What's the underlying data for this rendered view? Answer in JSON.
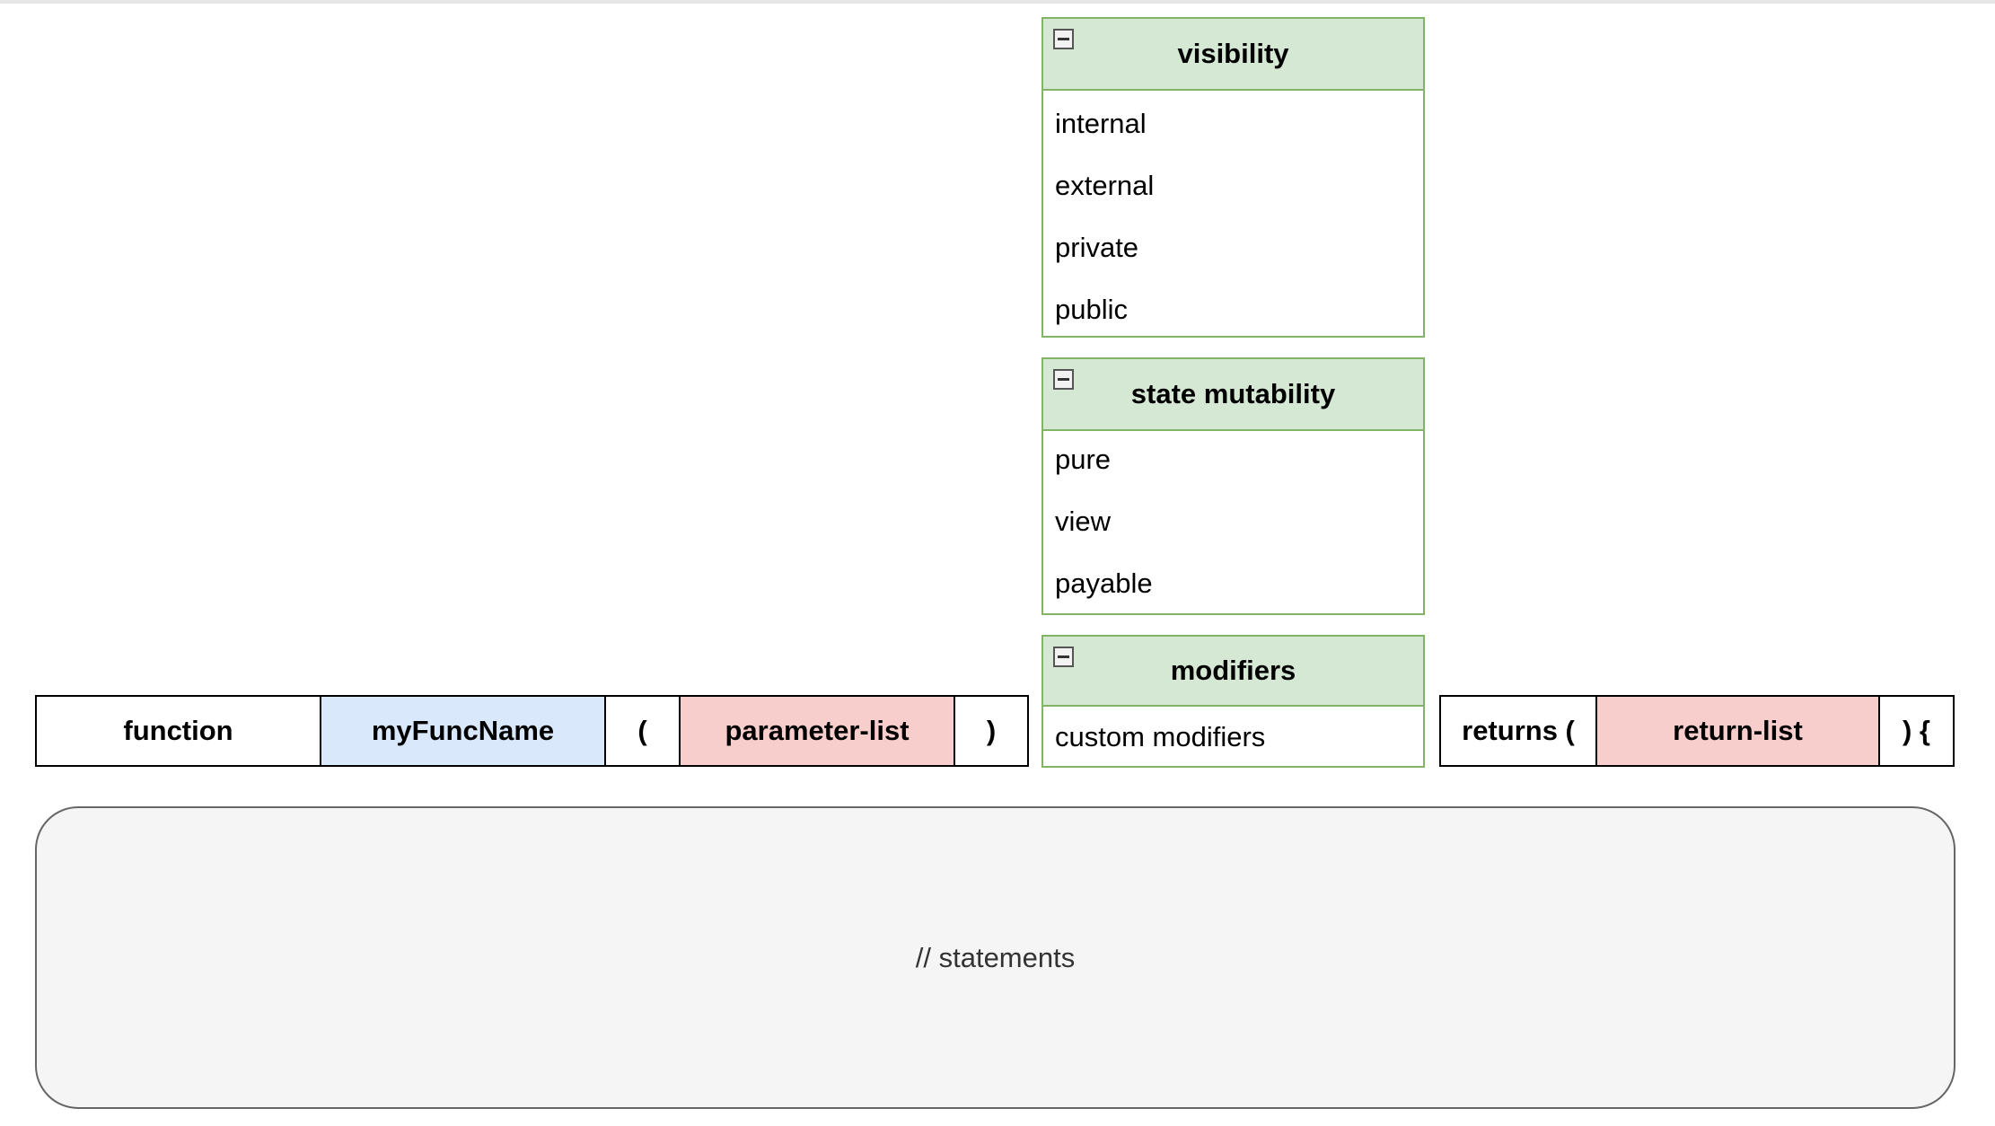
{
  "signature": {
    "keyword": "function",
    "name": "myFuncName",
    "open_paren": "(",
    "params": "parameter-list",
    "close_paren": ")",
    "returns_keyword": "returns (",
    "returns_list": "return-list",
    "close_brace": ") {"
  },
  "panels": {
    "visibility": {
      "title": "visibility",
      "items": [
        "internal",
        "external",
        "private",
        "public"
      ]
    },
    "state_mutability": {
      "title": "state mutability",
      "items": [
        "pure",
        "view",
        "payable"
      ]
    },
    "modifiers": {
      "title": "modifiers",
      "items": [
        "custom modifiers"
      ]
    }
  },
  "body": {
    "text": "// statements"
  },
  "colors": {
    "keyword_fill": "#ffffff",
    "name_fill": "#dae8fc",
    "name_stroke": "#6c8ebf",
    "list_fill": "#f8cecc",
    "list_stroke": "#b85450",
    "panel_fill": "#d5e8d4",
    "panel_stroke": "#82b366",
    "body_fill": "#f5f5f5",
    "body_stroke": "#666666"
  }
}
